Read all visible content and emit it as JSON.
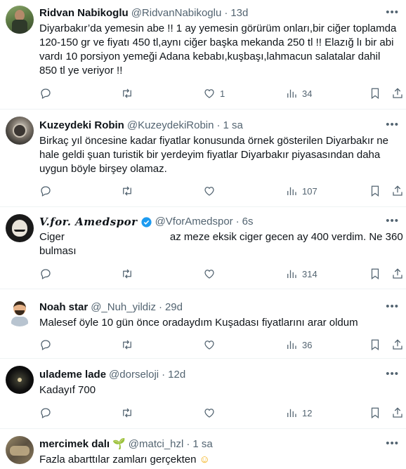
{
  "tweets": [
    {
      "name": "Ridvan Nabikoglu",
      "handle": "@RidvanNabikoglu",
      "time": "13d",
      "text": "Diyarbakır’da yemesin abe !! 1 ay yemesin görürüm onları,bir ciğer toplamda 120-150 gr ve fiyatı 450 tl,aynı ciğer başka mekanda 250 tl !! Elazığ lı bir abi vardı 10 porsiyon yemeği Adana kebabı,kuşbaşı,lahmacun salatalar dahil 850 tl ye veriyor !!",
      "likes": "1",
      "views": "34"
    },
    {
      "name": "Kuzeydeki Robin",
      "handle": "@KuzeydekiRobin",
      "time": "1 sa",
      "text": "Birkaç yıl öncesine kadar fiyatlar konusunda örnek gösterilen Diyarbakır ne hale geldi şuan turistik bir yerdeyim fiyatlar Diyarbakır piyasasından daha uygun böyle birşey olamaz.",
      "likes": "",
      "views": "107"
    },
    {
      "name": "V.for. Amedspor",
      "handle": "@VforAmedspor",
      "time": "6s",
      "text_a": "Ciger",
      "text_b": "az meze eksik ciger gecen ay 400 verdim. Ne 360 ı",
      "text_c": "bulması",
      "likes": "",
      "views": "314"
    },
    {
      "name": "Noah star",
      "handle": "@_Nuh_yildiz",
      "time": "29d",
      "text": "Malesef öyle 10 gün önce oradaydım Kuşadası fiyatlarını arar oldum",
      "likes": "",
      "views": "36"
    },
    {
      "name": "ulademe lade",
      "handle": "@dorseloji",
      "time": "12d",
      "text": "Kadayıf 700",
      "likes": "",
      "views": "12"
    },
    {
      "name": "mercimek dalı",
      "name_emoji": "🌱",
      "handle": "@matci_hzl",
      "time": "1 sa",
      "text": "Fazla abarttılar zamları gerçekten",
      "text_emoji": "☺"
    }
  ],
  "icons": {
    "more": "more-icon",
    "reply": "reply-icon",
    "retweet": "retweet-icon",
    "like": "heart-icon",
    "views": "views-icon",
    "bookmark": "bookmark-icon",
    "share": "share-icon",
    "verified": "verified-badge-icon"
  },
  "colors": {
    "secondary_text": "#536471",
    "verified": "#1d9bf0",
    "divider": "#eff3f4"
  }
}
